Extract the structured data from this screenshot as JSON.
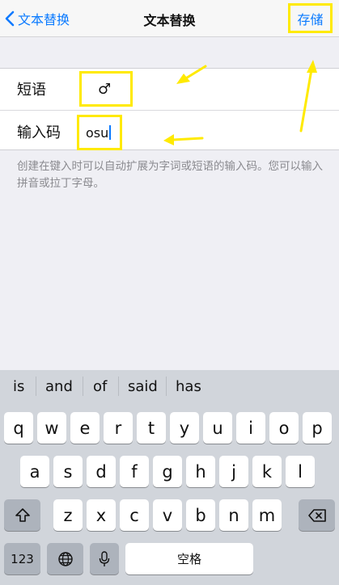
{
  "nav": {
    "back_label": "文本替换",
    "title": "文本替换",
    "save_label": "存储"
  },
  "form": {
    "phrase_label": "短语",
    "phrase_value": "♂",
    "shortcut_label": "输入码",
    "shortcut_value": "osu"
  },
  "hint": "创建在键入时可以自动扩展为字词或短语的输入码。您可以输入拼音或拉丁字母。",
  "suggestions": [
    "is",
    "and",
    "of",
    "said",
    "has"
  ],
  "keyboard": {
    "row1": [
      "q",
      "w",
      "e",
      "r",
      "t",
      "y",
      "u",
      "i",
      "o",
      "p"
    ],
    "row2": [
      "a",
      "s",
      "d",
      "f",
      "g",
      "h",
      "j",
      "k",
      "l"
    ],
    "row3": [
      "z",
      "x",
      "c",
      "v",
      "b",
      "n",
      "m"
    ],
    "numbers_label": "123",
    "space_label": "空格",
    "icons": {
      "shift": "shift-icon",
      "delete": "delete-icon",
      "globe": "globe-icon",
      "mic": "microphone-icon"
    }
  },
  "colors": {
    "accent": "#0a7aff",
    "highlight": "#ffea00"
  }
}
